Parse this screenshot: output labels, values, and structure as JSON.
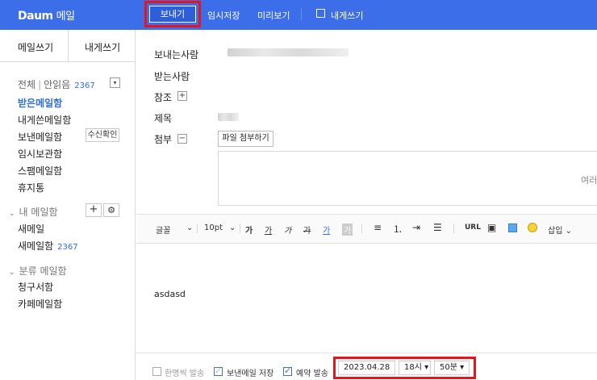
{
  "app": {
    "logo": "Daum",
    "service": "메일"
  },
  "toolbar": {
    "send_label": "보내기",
    "save_draft_label": "임시저장",
    "preview_label": "미리보기",
    "self_write_label": "내게쓰기"
  },
  "sidebar": {
    "tabs": [
      "메일쓰기",
      "내게쓰기"
    ],
    "all": "전체",
    "unread": "안읽음",
    "unread_count": "2367",
    "items": [
      {
        "label": "받은메일함"
      },
      {
        "label": "내게쓴메일함"
      },
      {
        "label": "보낸메일함",
        "badge": "수신확인"
      },
      {
        "label": "임시보관함"
      },
      {
        "label": "스팸메일함"
      },
      {
        "label": "휴지통"
      }
    ],
    "my_mailbox": {
      "title": "내 메일함",
      "items": [
        {
          "label": "새메일",
          "count": ""
        },
        {
          "label": "새메일함",
          "count": "2367"
        }
      ]
    },
    "categories": {
      "title": "분류 메일함",
      "items": [
        {
          "label": "청구서함"
        },
        {
          "label": "카페메일함"
        }
      ]
    }
  },
  "compose": {
    "from_label": "보내는사람",
    "to_label": "받는사람",
    "cc_label": "참조",
    "subject_label": "제목",
    "attach_label": "첨부",
    "attach_button": "파일 첨부하기",
    "attach_hint": "여러",
    "body_text": "asdasd"
  },
  "editor_toolbar": {
    "font": "글꼴",
    "size": "10pt",
    "bold": "가",
    "underline": "가",
    "italic": "가",
    "strike": "가",
    "color": "가",
    "url": "URL",
    "insert": "삽입"
  },
  "bottom": {
    "individual_send": "한명씩 발송",
    "save_sent": "보낸메일 저장",
    "reserve_send": "예약 발송",
    "date": "2023.04.28",
    "hour": "18시",
    "minute": "50분"
  },
  "colors": {
    "accent": "#3b6ee8",
    "highlight": "#e8131b",
    "link": "#2e6de0"
  }
}
